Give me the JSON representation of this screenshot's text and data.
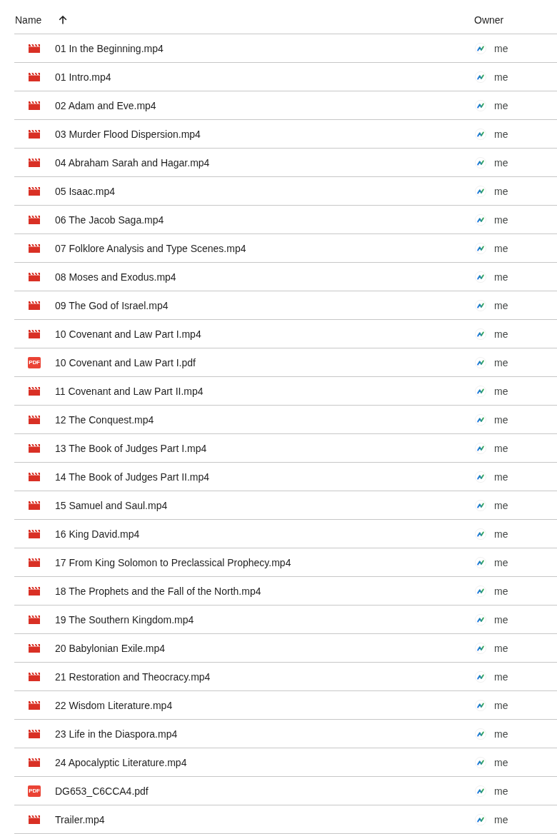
{
  "table": {
    "columns": [
      {
        "label": "Name",
        "sorted": true,
        "ascending": true
      },
      {
        "label": "Owner",
        "sorted": false
      }
    ],
    "rows": [
      {
        "kind": "video",
        "name": "01 In the Beginning.mp4",
        "owner": "me"
      },
      {
        "kind": "video",
        "name": "01 Intro.mp4",
        "owner": "me"
      },
      {
        "kind": "video",
        "name": "02 Adam and Eve.mp4",
        "owner": "me"
      },
      {
        "kind": "video",
        "name": "03 Murder Flood Dispersion.mp4",
        "owner": "me"
      },
      {
        "kind": "video",
        "name": "04 Abraham Sarah and Hagar.mp4",
        "owner": "me"
      },
      {
        "kind": "video",
        "name": "05 Isaac.mp4",
        "owner": "me"
      },
      {
        "kind": "video",
        "name": "06 The Jacob Saga.mp4",
        "owner": "me"
      },
      {
        "kind": "video",
        "name": "07 Folklore Analysis and Type Scenes.mp4",
        "owner": "me"
      },
      {
        "kind": "video",
        "name": "08 Moses and Exodus.mp4",
        "owner": "me"
      },
      {
        "kind": "video",
        "name": "09 The God of Israel.mp4",
        "owner": "me"
      },
      {
        "kind": "video",
        "name": "10 Covenant and Law Part I.mp4",
        "owner": "me"
      },
      {
        "kind": "pdf",
        "icon_text": "PDF",
        "name": "10 Covenant and Law Part I.pdf",
        "owner": "me"
      },
      {
        "kind": "video",
        "name": "11 Covenant and Law Part II.mp4",
        "owner": "me"
      },
      {
        "kind": "video",
        "name": "12 The Conquest.mp4",
        "owner": "me"
      },
      {
        "kind": "video",
        "name": "13 The Book of Judges Part I.mp4",
        "owner": "me"
      },
      {
        "kind": "video",
        "name": "14 The Book of Judges Part II.mp4",
        "owner": "me"
      },
      {
        "kind": "video",
        "name": "15 Samuel and Saul.mp4",
        "owner": "me"
      },
      {
        "kind": "video",
        "name": "16 King David.mp4",
        "owner": "me"
      },
      {
        "kind": "video",
        "name": "17 From King Solomon to Preclassical Prophecy.mp4",
        "owner": "me"
      },
      {
        "kind": "video",
        "name": "18 The Prophets and the Fall of the North.mp4",
        "owner": "me"
      },
      {
        "kind": "video",
        "name": "19 The Southern Kingdom.mp4",
        "owner": "me"
      },
      {
        "kind": "video",
        "name": "20 Babylonian Exile.mp4",
        "owner": "me"
      },
      {
        "kind": "video",
        "name": "21 Restoration and Theocracy.mp4",
        "owner": "me"
      },
      {
        "kind": "video",
        "name": "22 Wisdom Literature.mp4",
        "owner": "me"
      },
      {
        "kind": "video",
        "name": "23 Life in the Diaspora.mp4",
        "owner": "me"
      },
      {
        "kind": "video",
        "name": "24 Apocalyptic Literature.mp4",
        "owner": "me"
      },
      {
        "kind": "pdf",
        "icon_text": "PDF",
        "name": "DG653_C6CCA4.pdf",
        "owner": "me"
      },
      {
        "kind": "video",
        "name": "Trailer.mp4",
        "owner": "me"
      }
    ]
  }
}
